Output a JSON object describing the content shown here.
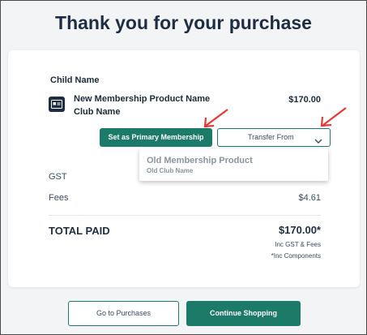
{
  "page_title": "Thank you for your purchase",
  "order": {
    "child_name": "Child Name",
    "product_name": "New Membership Product Name",
    "club_name": "Club Name",
    "product_price": "$170.00",
    "primary_button": "Set as Primary Membership",
    "transfer_button": "Transfer From",
    "dropdown": {
      "product": "Old Membership Product",
      "club": "Old Club Name"
    },
    "gst_label": "GST",
    "gst_value": "",
    "fees_label": "Fees",
    "fees_value": "$4.61",
    "total_label": "TOTAL PAID",
    "total_value": "$170.00*",
    "inc_gst_fees": "Inc GST & Fees",
    "inc_components": "*Inc Components"
  },
  "footer": {
    "purchases_button": "Go to Purchases",
    "continue_button": "Continue Shopping"
  },
  "colors": {
    "primary": "#1b7a68",
    "annotation": "#e53935"
  },
  "icons": {
    "product": "membership-card-icon",
    "dropdown": "chevron-down-icon"
  }
}
